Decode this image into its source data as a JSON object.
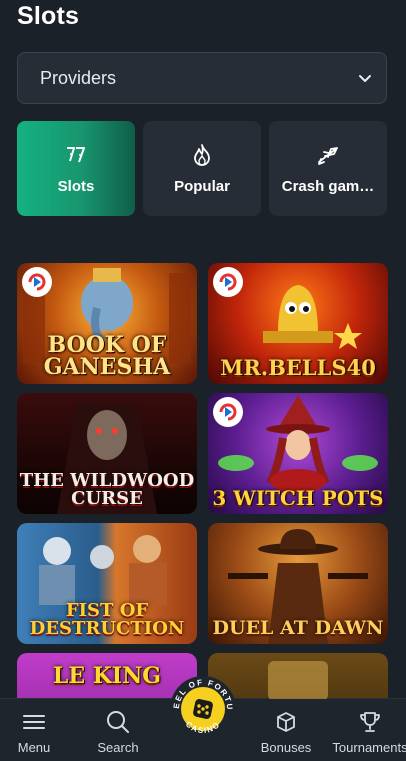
{
  "header": {
    "title": "Slots"
  },
  "providers": {
    "label": "Providers"
  },
  "categories": [
    {
      "label": "Slots",
      "icon": "sevens-icon",
      "active": true
    },
    {
      "label": "Popular",
      "icon": "flame-icon",
      "active": false
    },
    {
      "label": "Crash gam…",
      "icon": "plane-icon",
      "active": false
    }
  ],
  "games": [
    {
      "title": "BOOK OF\nGANESHA",
      "provider_badge": true
    },
    {
      "title": "MR.BELLS40",
      "provider_badge": true
    },
    {
      "title": "THE WILDWOOD\nCURSE",
      "provider_badge": false
    },
    {
      "title": "3 WITCH POTS",
      "provider_badge": true
    },
    {
      "title": "FIST OF\nDESTRUCTION",
      "provider_badge": false
    },
    {
      "title": "DUEL AT DAWN",
      "provider_badge": false
    },
    {
      "title": "LE KING",
      "provider_badge": false
    },
    {
      "title": "",
      "provider_badge": false
    }
  ],
  "bottom_nav": {
    "menu": "Menu",
    "search": "Search",
    "casino": "CASINO",
    "casino_arc_top": "WHEEL OF FORTUNE",
    "bonuses": "Bonuses",
    "tournaments": "Tournaments"
  },
  "colors": {
    "background": "#1b2129",
    "card": "#262d36",
    "accent_green": "#14b281",
    "casino_yellow": "#f5d020"
  }
}
